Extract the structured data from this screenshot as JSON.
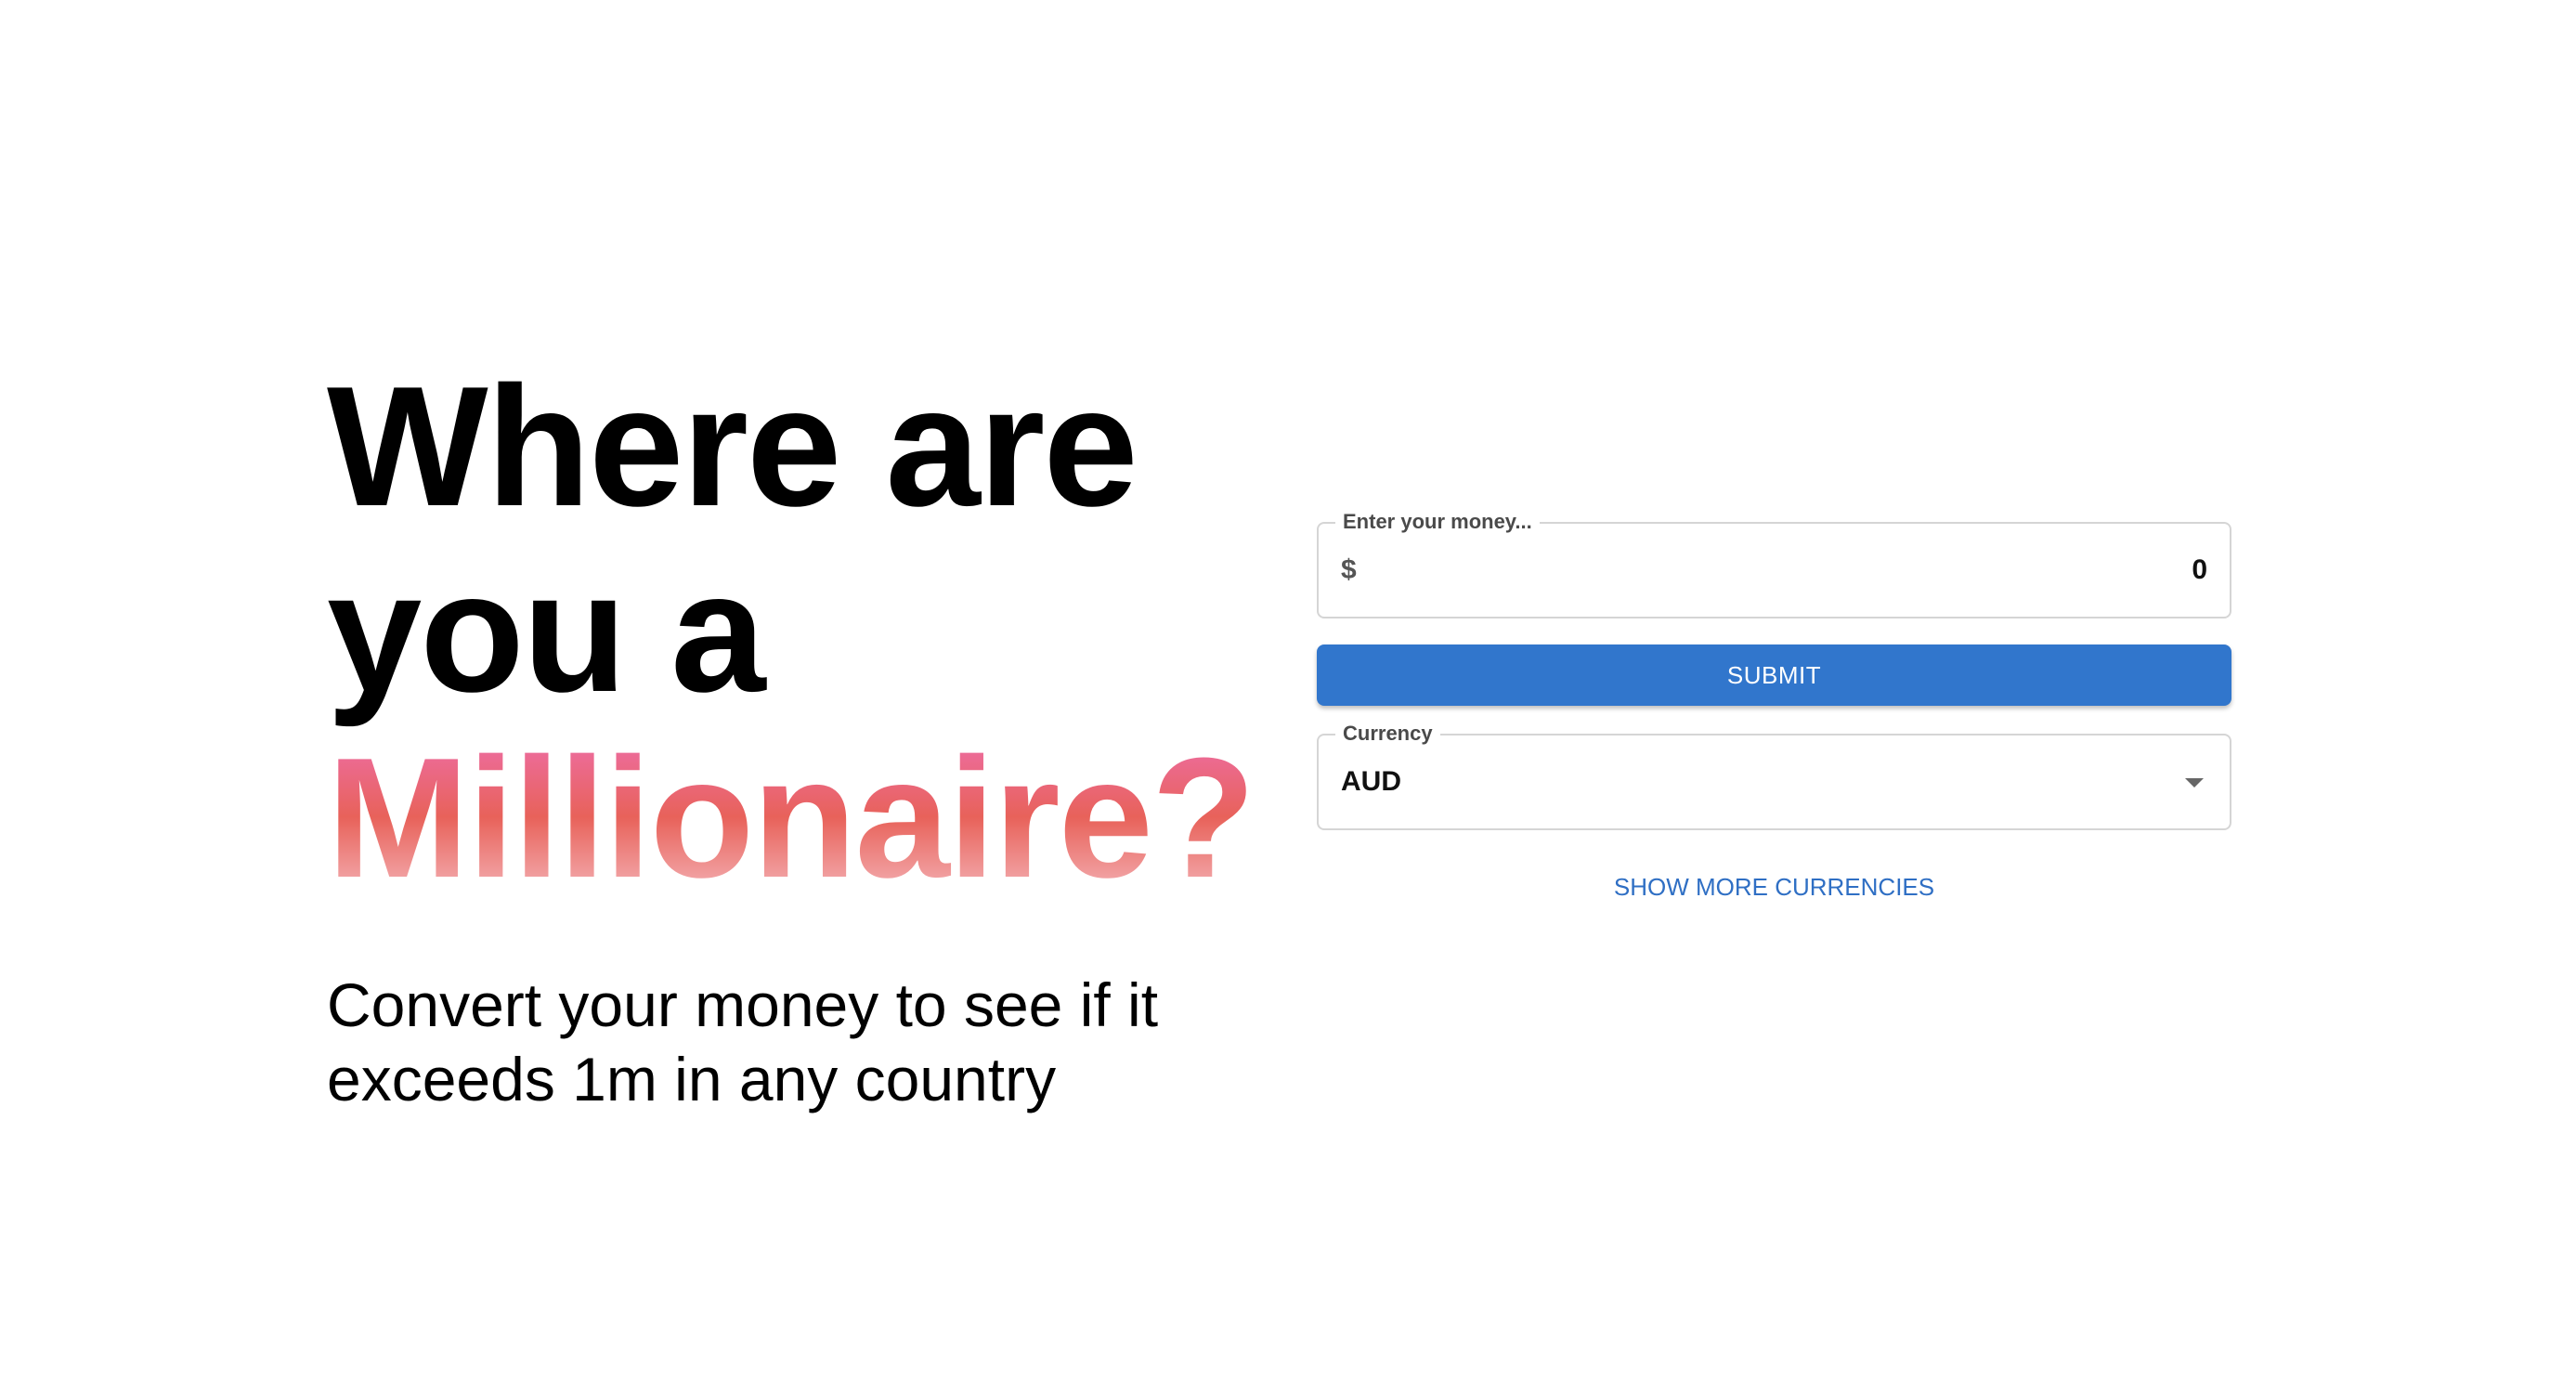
{
  "hero": {
    "title_line1": "Where are",
    "title_line2": "you a",
    "title_accent": "Millionaire?",
    "subtitle_line1": "Convert your money to see if it",
    "subtitle_line2": "exceeds 1m in any country",
    "accent_gradient": [
      "#ee6fb0",
      "#e8625a",
      "#f6c0c6"
    ]
  },
  "form": {
    "money_field": {
      "label": "Enter your money...",
      "symbol": "$",
      "value": "0"
    },
    "submit_label": "SUBMIT",
    "currency_field": {
      "label": "Currency",
      "selected": "AUD",
      "icon": "chevron-down-icon"
    },
    "show_more_label": "SHOW MORE CURRENCIES"
  },
  "colors": {
    "primary": "#3176cc",
    "link": "#2f6fc4",
    "border": "#d5d5d5"
  }
}
